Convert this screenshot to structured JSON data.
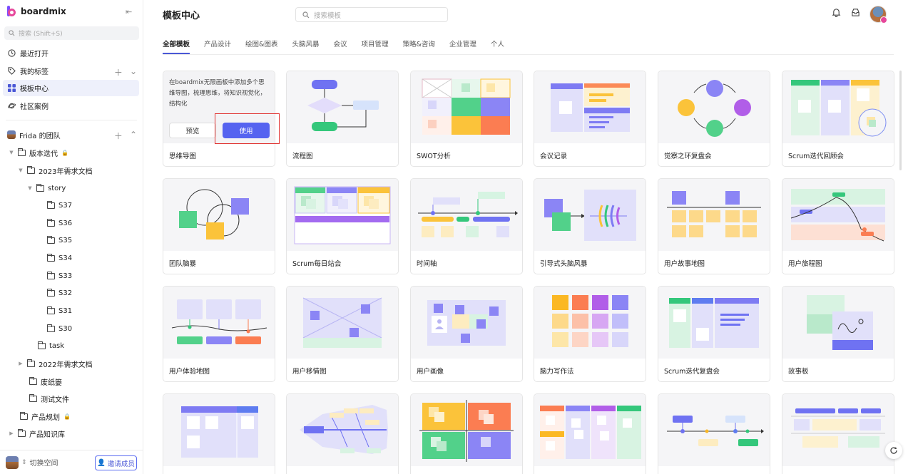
{
  "sidebar": {
    "logo_text": "boardmix",
    "search_placeholder": "搜索 (Shift+S)",
    "nav": [
      {
        "label": "最近打开",
        "icon": "clock-icon"
      },
      {
        "label": "我的标签",
        "icon": "tag-icon"
      },
      {
        "label": "模板中心",
        "icon": "grid-icon",
        "active": true
      },
      {
        "label": "社区案例",
        "icon": "planet-icon"
      }
    ],
    "team": {
      "label": "Frida 的团队"
    },
    "tree": [
      {
        "label": "版本迭代",
        "locked": true
      },
      {
        "label": "2023年需求文档"
      },
      {
        "label": "story"
      },
      {
        "label": "S37"
      },
      {
        "label": "S36"
      },
      {
        "label": "S35"
      },
      {
        "label": "S34"
      },
      {
        "label": "S33"
      },
      {
        "label": "S32"
      },
      {
        "label": "S31"
      },
      {
        "label": "S30"
      },
      {
        "label": "task"
      },
      {
        "label": "2022年需求文档"
      },
      {
        "label": "废纸篓"
      },
      {
        "label": "测试文件"
      },
      {
        "label": "产品规划",
        "locked": true
      },
      {
        "label": "产品知识库"
      }
    ],
    "switch_label": "切换空间",
    "invite_label": "邀请成员"
  },
  "header": {
    "title": "模板中心",
    "search_placeholder": "搜索模板"
  },
  "tabs": [
    "全部模板",
    "产品设计",
    "绘图&图表",
    "头脑风暴",
    "会议",
    "项目管理",
    "策略&咨询",
    "企业管理",
    "个人"
  ],
  "active_tab": "全部模板",
  "first_card": {
    "description": "在boardmix无限画板中添加多个思维导图，梳理思维，将知识视觉化，结构化",
    "preview_label": "预览",
    "use_label": "使用"
  },
  "templates": [
    "思维导图",
    "流程图",
    "SWOT分析",
    "会议记录",
    "觉察之环复盘会",
    "Scrum迭代回顾会",
    "团队脑暴",
    "Scrum每日站会",
    "时间轴",
    "引导式头脑风暴",
    "用户故事地图",
    "用户旅程图",
    "用户体验地图",
    "用户移情图",
    "用户画像",
    "脑力写作法",
    "Scrum迭代复盘会",
    "故事板",
    "",
    "",
    "",
    "",
    "",
    ""
  ],
  "colors": {
    "accent": "#5563f0",
    "purple": "#8b85f5",
    "green": "#52d18a",
    "yellow": "#fbc33a",
    "orange": "#fb7d52",
    "light_purple": "#e3e2fb"
  }
}
